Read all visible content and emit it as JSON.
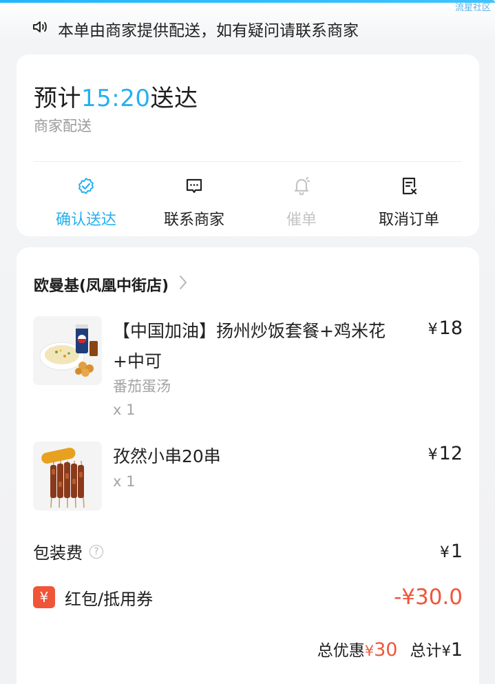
{
  "watermark": "流星社区",
  "notice": {
    "icon": "speaker-icon",
    "text": "本单由商家提供配送，如有疑问请联系商家"
  },
  "delivery": {
    "eta_prefix": "预计",
    "eta_time": "15:20",
    "eta_suffix": "送达",
    "method": "商家配送",
    "actions": [
      {
        "label": "确认送达",
        "icon": "check-circle-icon",
        "state": "active",
        "color": "#25b0ef"
      },
      {
        "label": "联系商家",
        "icon": "chat-icon",
        "state": "normal"
      },
      {
        "label": "催单",
        "icon": "bell-icon",
        "state": "disabled"
      },
      {
        "label": "取消订单",
        "icon": "cancel-order-icon",
        "state": "normal"
      }
    ]
  },
  "order": {
    "shop_name": "欧曼基(凤凰中街店)",
    "currency": "¥",
    "items": [
      {
        "name": "【中国加油】扬州炒饭套餐+鸡米花+中可",
        "spec": "番茄蛋汤",
        "qty": "x 1",
        "price": "18",
        "image": "fried-rice-combo-image"
      },
      {
        "name": "孜然小串20串",
        "qty": "x 1",
        "price": "12",
        "image": "skewers-image",
        "image_text": "孜然小串"
      }
    ],
    "packaging": {
      "label": "包装费",
      "value": "1"
    },
    "coupon": {
      "icon_text": "¥",
      "label": "红包/抵用券",
      "value": "-¥30.0"
    },
    "totals": {
      "discount_label": "总优惠",
      "discount_value": "30",
      "total_label": "总计",
      "total_value": "1"
    }
  },
  "colors": {
    "accent": "#25b0ef",
    "discount": "#f0553a",
    "muted": "#a3a3a3"
  }
}
